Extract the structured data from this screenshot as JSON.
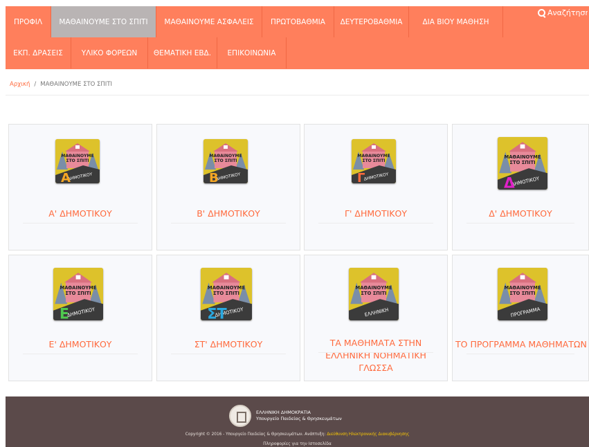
{
  "nav": {
    "row1": [
      {
        "label": "ΠΡΟΦΙΛ",
        "active": false
      },
      {
        "label": "ΜΑΘΑΙΝΟΥΜΕ ΣΤΟ ΣΠΙΤΙ",
        "active": true
      },
      {
        "label": "ΜΑΘΑΙΝΟΥΜΕ ΑΣΦΑΛΕΙΣ",
        "active": false
      },
      {
        "label": "ΠΡΩΤΟΒΑΘΜΙΑ",
        "active": false
      },
      {
        "label": "ΔΕΥΤΕΡΟΒΑΘΜΙΑ",
        "active": false
      },
      {
        "label": "ΔΙΑ ΒΙΟΥ ΜΑΘΗΣΗ",
        "active": false
      }
    ],
    "row2": [
      {
        "label": "ΕΚΠ. ΔΡΑΣΕΙΣ"
      },
      {
        "label": "ΥΛΙΚΟ ΦΟΡΕΩΝ"
      },
      {
        "label": "ΘΕΜΑΤΙΚΗ ΕΒΔ."
      },
      {
        "label": "ΕΠΙΚΟΙΝΩΝΙΑ"
      }
    ],
    "search_placeholder": "Αναζήτηση..."
  },
  "breadcrumb": {
    "home": "Αρχική",
    "separator": "/",
    "current": "ΜΑΘΑΙΝΟΥΜΕ ΣΤΟ ΣΠΙΤΙ"
  },
  "cards": [
    {
      "label": "Α' ΔΗΜΟΤΙΚΟΥ",
      "icon_text": "ΔΗΜΟΤΙΚΟΥ",
      "letter": "Α",
      "letter_color": "#f5a623",
      "icon": "house-icon"
    },
    {
      "label": "Β' ΔΗΜΟΤΙΚΟΥ",
      "icon_text": "ΔΗΜΟΤΙΚΟΥ",
      "letter": "Β",
      "letter_color": "#f5a623",
      "icon": "house-icon"
    },
    {
      "label": "Γ' ΔΗΜΟΤΙΚΟΥ",
      "icon_text": "ΔΗΜΟΤΙΚΟΥ",
      "letter": "Γ",
      "letter_color": "#ff6a3d",
      "icon": "house-icon"
    },
    {
      "label": "Δ' ΔΗΜΟΤΙΚΟΥ",
      "icon_text": "ΔΗΜΟΤΙΚΟΥ",
      "letter": "Δ",
      "letter_color": "#e020c8",
      "icon": "house-icon"
    },
    {
      "label": "Ε' ΔΗΜΟΤΙΚΟΥ",
      "icon_text": "ΔΗΜΟΤΙΚΟΥ",
      "letter": "Ε",
      "letter_color": "#4fc94f",
      "icon": "house-icon"
    },
    {
      "label": "ΣΤ' ΔΗΜΟΤΙΚΟΥ",
      "icon_text": "ΔΗΜΟΤΙΚΟΥ",
      "letter": "ΣΤ",
      "letter_color": "#2aa8e0",
      "icon": "house-icon"
    },
    {
      "label": "ΤΑ ΜΑΘΗΜΑΤΑ ΣΤΗΝ ΕΛΛΗΝΙΚΗ ΝΟΗΜΑΤΙΚΗ ΓΛΩΣΣΑ",
      "icon_text": "ΕΛΛΗΝΙΚΗ",
      "letter": "",
      "letter_color": "#e0c22d",
      "icon": "house-icon"
    },
    {
      "label": "ΤΟ ΠΡΟΓΡΑΜΜΑ ΜΑΘΗΜΑΤΩΝ",
      "icon_text": "ΠΡΟΓΡΑΜΜΑ",
      "letter": "",
      "letter_color": "#e0c22d",
      "icon": "house-icon"
    }
  ],
  "icon_title": "ΜΑΘΑΙΝΟΥΜΕ ΣΤΟ ΣΠΙΤΙ",
  "footer": {
    "gov_line1": "ΕΛΛΗΝΙΚΗ ΔΗΜΟΚΡΑΤΙΑ",
    "gov_line2": "Υπουργείο Παιδείας & Θρησκευμάτων",
    "copyright_prefix": "Copyright © 2016 - Υπουργείο Παιδείας & Θρησκευμάτων. Ανάπτυξη: ",
    "copyright_dev": "Διεύθυνση Ηλεκτρονικής Διακυβέρνησης",
    "info": "Πληροφορίες για την Ιστοσελίδα"
  },
  "colors": {
    "accent": "#ff7f5c",
    "active_tab": "#b9b4b4",
    "card_label": "#ff6a3d",
    "footer_bg": "#5b4a4a"
  }
}
